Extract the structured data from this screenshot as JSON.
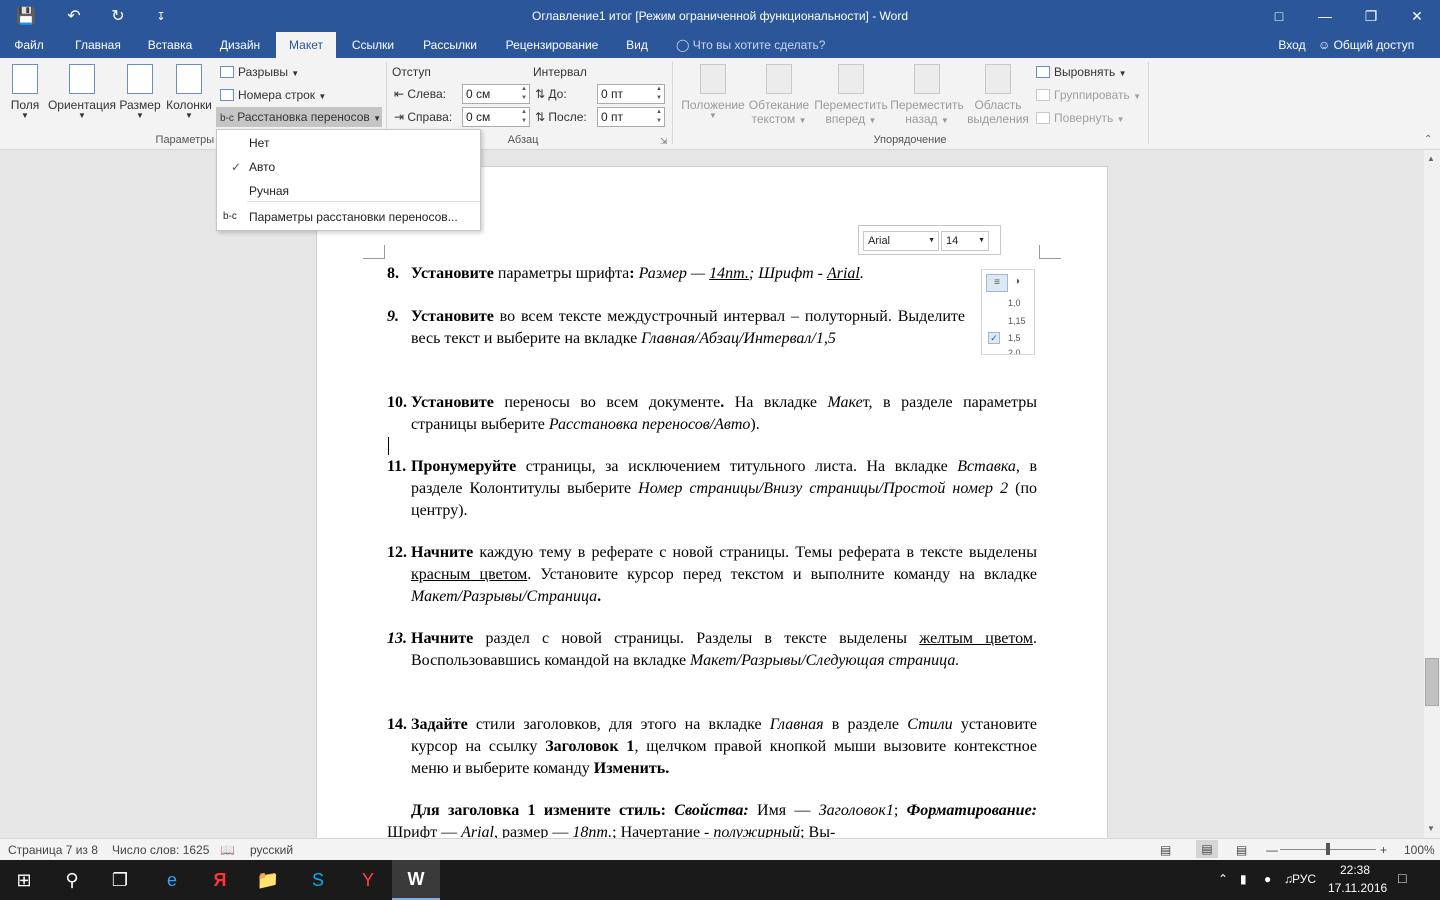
{
  "window": {
    "title": "Оглавление1 итог [Режим ограниченной функциональности] - Word",
    "qat": {
      "save_icon": "save-icon",
      "undo_icon": "undo-icon",
      "redo_icon": "redo-icon",
      "customize_icon": "customize-qat-icon"
    }
  },
  "tabs": [
    {
      "label": "Файл"
    },
    {
      "label": "Главная"
    },
    {
      "label": "Вставка"
    },
    {
      "label": "Дизайн"
    },
    {
      "label": "Макет"
    },
    {
      "label": "Ссылки"
    },
    {
      "label": "Рассылки"
    },
    {
      "label": "Рецензирование"
    },
    {
      "label": "Вид"
    }
  ],
  "tell_me": "Что вы хотите сделать?",
  "signin": "Вход",
  "share": "Общий доступ",
  "ribbon": {
    "page_setup": {
      "fields_label": "Поля",
      "orientation_label": "Ориентация",
      "size_label": "Размер",
      "columns_label": "Колонки",
      "breaks_label": "Разрывы",
      "line_numbers_label": "Номера строк",
      "hyphenation_label": "Расстановка переносов",
      "group_label": "Параметры стра"
    },
    "paragraph": {
      "indent_label": "Отступ",
      "spacing_label": "Интервал",
      "left_label": "Слева:",
      "right_label": "Справа:",
      "before_label": "До:",
      "after_label": "После:",
      "left_value": "0 см",
      "right_value": "0 см",
      "before_value": "0 пт",
      "after_value": "0 пт",
      "group_label": "Абзац"
    },
    "arrange": {
      "position_label": "Положение",
      "wrap_label_1": "Обтекание",
      "wrap_label_2": "текстом",
      "forward_label_1": "Переместить",
      "forward_label_2": "вперед",
      "backward_label_1": "Переместить",
      "backward_label_2": "назад",
      "selection_label_1": "Область",
      "selection_label_2": "выделения",
      "align_label": "Выровнять",
      "group_btn_label": "Группировать",
      "rotate_label": "Повернуть",
      "group_label": "Упорядочение"
    }
  },
  "hyphenation_menu": {
    "items": [
      {
        "label": "Нет",
        "checked": false
      },
      {
        "label": "Авто",
        "checked": true
      },
      {
        "label": "Ручная",
        "checked": false
      }
    ],
    "options_label": "Параметры расстановки переносов...",
    "check_mark": "✓"
  },
  "mini_toolbar": {
    "font": "Arial",
    "size": "14"
  },
  "line_spacing_mini": {
    "values": [
      "1,0",
      "1,15",
      "1,5",
      "2,0"
    ],
    "selected": "1,5"
  },
  "document": {
    "p8": {
      "num": "8.",
      "b1": "Установите",
      "t1": " параметры шрифта",
      "b2": ":",
      "i1": " Размер — ",
      "iu1": "14пт.",
      "i2": "; Шрифт - ",
      "iu2": "Arial",
      "i3": "."
    },
    "p9": {
      "num": "9.",
      "b1": "Установите",
      "t1": " во всем тексте междустрочный интервал – полуторный. Выделите весь текст и выберите на вкладке ",
      "i1": "Главная/Абзац/Интервал/1,5"
    },
    "p10": {
      "num": "10.",
      "b1": "Установите",
      "t1": " переносы во всем документе",
      "b2": ".",
      "t2": " На вкладке ",
      "i1": "Маке",
      "t3": "т, в разделе параметры страницы выберите ",
      "i2": "Расстановка переносов/Авто",
      "t4": ")."
    },
    "p11": {
      "num": "11.",
      "b1": "Пронумеруйте",
      "t1": " страницы, за исключением титульного листа. На вкладке ",
      "i1": "Вставка",
      "t2": ", в разделе Колонтитулы выберите ",
      "i2": "Номер страницы/Внизу страницы/Простой номер 2",
      "t3": " (по центру)."
    },
    "p12": {
      "num": "12.",
      "b1": "Начните",
      "t1": " каждую тему в реферате с новой страницы. Темы реферата в тексте выделены ",
      "u1": "красным цветом",
      "t2": ". Установите курсор перед текстом и выполните команду на вкладке ",
      "i1": "Макет/Разрывы/Страница",
      "b2": "."
    },
    "p13": {
      "num": "13.",
      "b1": "Начните",
      "t1": " раздел с новой страницы. Разделы в тексте выделены ",
      "u1": "желтым цветом",
      "t2": ". Воспользовавшись командой на вкладке ",
      "i1": "Макет/Разрывы/Следующая страница."
    },
    "p14": {
      "num": "14.",
      "b1": "Задайте",
      "t1": " стили заголовков, для этого на вкладке ",
      "i1": "Главная",
      "t2": " в разделе ",
      "i2": "Стили",
      "t3": " установите курсор на ссылку ",
      "b2": "Заголовок 1",
      "t4": ", щелчком правой кнопкой мыши вызовите контекстное меню и выберите команду ",
      "b3": "Изменить."
    },
    "p15": {
      "b1": "Для заголовка 1 измените стиль: ",
      "bi1": "Свойства:",
      "t1": " Имя — ",
      "i1": "Заголовок1",
      "t2": "; ",
      "bi2": "Форматирование:",
      "t3": " Шрифт — ",
      "i2": "Arial",
      "t4": ", размер — ",
      "i3": "18пт.",
      "t5": "; Начертание - ",
      "iu1": "полужирный",
      "t6": "; Вы-"
    }
  },
  "status": {
    "page": "Страница 7 из 8",
    "words": "Число слов: 1625",
    "language": "русский",
    "zoom": "100%",
    "zoom_fraction": 0.5
  },
  "taskbar": {
    "lang": "РУС",
    "time": "22:38",
    "date": "17.11.2016"
  }
}
